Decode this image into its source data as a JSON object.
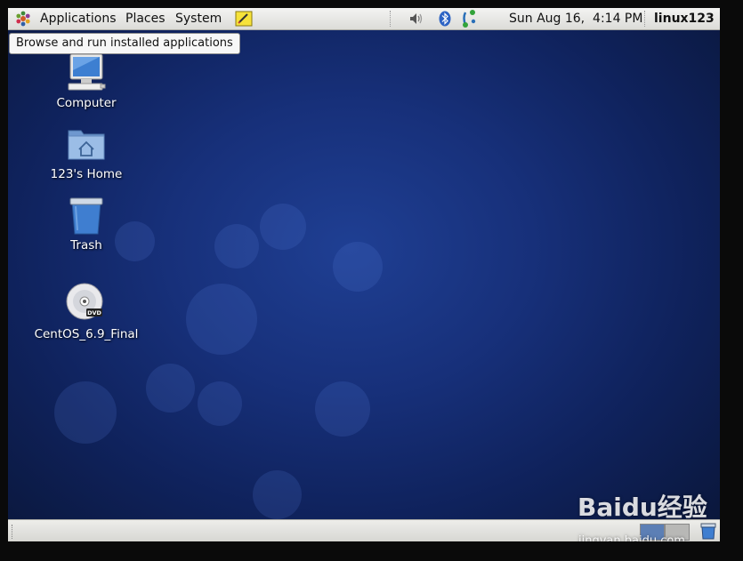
{
  "top_panel": {
    "menus": {
      "applications": "Applications",
      "places": "Places",
      "system": "System"
    },
    "clock": "Sun Aug 16,  4:14 PM",
    "username": "linux123"
  },
  "tooltip": "Browse and run installed applications",
  "desktop": {
    "icons": {
      "computer": "Computer",
      "home": "123's Home",
      "trash": "Trash",
      "dvd": "CentOS_6.9_Final"
    },
    "dvd_badge": "DVD"
  },
  "watermark": {
    "logo": "Baidu经验",
    "url": "jingyan.baidu.com"
  },
  "colors": {
    "desktop_background": "#17307a",
    "panel": "#e6e6e3",
    "workspace_active": "#5c7fb5"
  },
  "icons": [
    "gnome-foot-icon",
    "sticky-notes-icon",
    "volume-icon",
    "bluetooth-icon",
    "network-icon",
    "computer-icon",
    "home-folder-icon",
    "trash-icon",
    "dvd-icon"
  ]
}
